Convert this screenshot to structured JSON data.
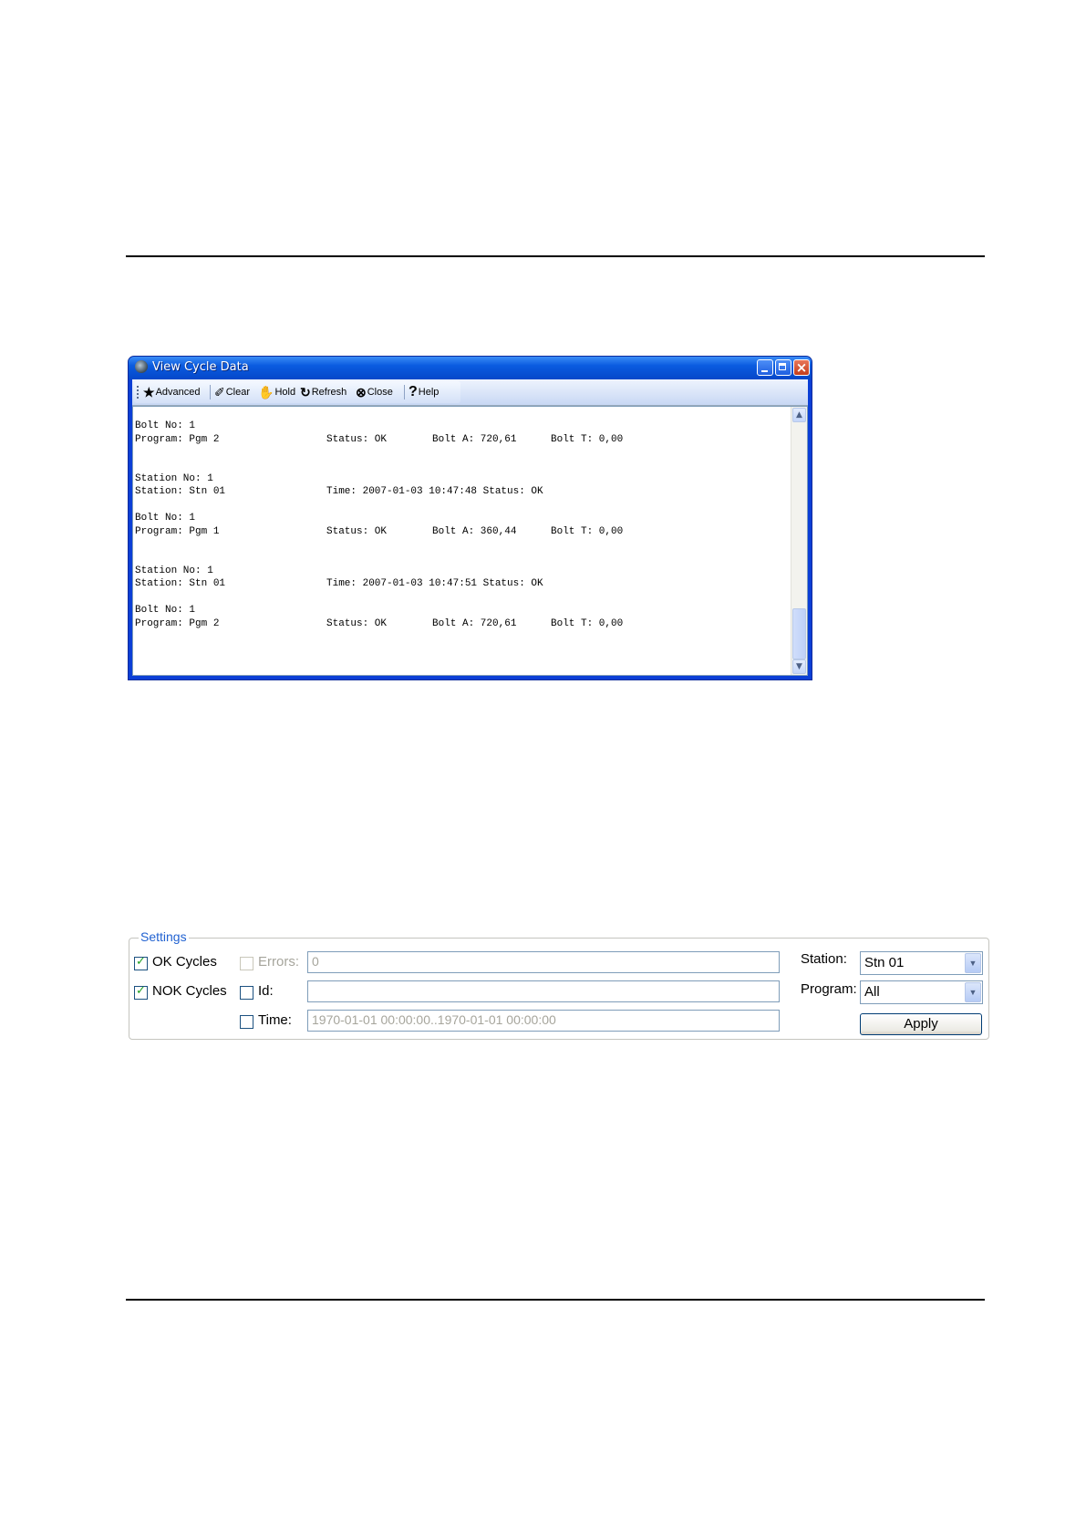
{
  "window": {
    "title": "View Cycle Data",
    "toolbar": {
      "advanced": "Advanced",
      "clear": "Clear",
      "hold": "Hold",
      "refresh": "Refresh",
      "close": "Close",
      "help": "Help"
    },
    "log": [
      {
        "c1": "Bolt No: 1",
        "c2": "",
        "c3": "",
        "c4": ""
      },
      {
        "c1": "Program: Pgm 2",
        "c2": "Status: OK",
        "c3": "Bolt A: 720,61",
        "c4": "Bolt T: 0,00"
      },
      {
        "c1": "Station No: 1",
        "c2": "",
        "c3": "",
        "c4": ""
      },
      {
        "c1": "Station: Stn 01",
        "c2": "Time: 2007-01-03 10:47:48 Status: OK",
        "c3": "",
        "c4": ""
      },
      {
        "c1": "Bolt No: 1",
        "c2": "",
        "c3": "",
        "c4": ""
      },
      {
        "c1": "Program: Pgm 1",
        "c2": "Status: OK",
        "c3": "Bolt A: 360,44",
        "c4": "Bolt T: 0,00"
      },
      {
        "c1": "Station No: 1",
        "c2": "",
        "c3": "",
        "c4": ""
      },
      {
        "c1": "Station: Stn 01",
        "c2": "Time: 2007-01-03 10:47:51 Status: OK",
        "c3": "",
        "c4": ""
      },
      {
        "c1": "Bolt No: 1",
        "c2": "",
        "c3": "",
        "c4": ""
      },
      {
        "c1": "Program: Pgm 2",
        "c2": "Status: OK",
        "c3": "Bolt A: 720,61",
        "c4": "Bolt T: 0,00"
      }
    ]
  },
  "settings": {
    "legend": "Settings",
    "ok_cycles": {
      "label": "OK Cycles",
      "checked": true
    },
    "nok_cycles": {
      "label": "NOK Cycles",
      "checked": true
    },
    "errors": {
      "label": "Errors:",
      "value": "0",
      "enabled": false
    },
    "id": {
      "label": "Id:",
      "value": ""
    },
    "time": {
      "label": "Time:",
      "value": "1970-01-01 00:00:00..1970-01-01 00:00:00"
    },
    "station": {
      "label": "Station:",
      "selected": "Stn 01"
    },
    "program": {
      "label": "Program:",
      "selected": "All"
    },
    "apply": "Apply"
  }
}
